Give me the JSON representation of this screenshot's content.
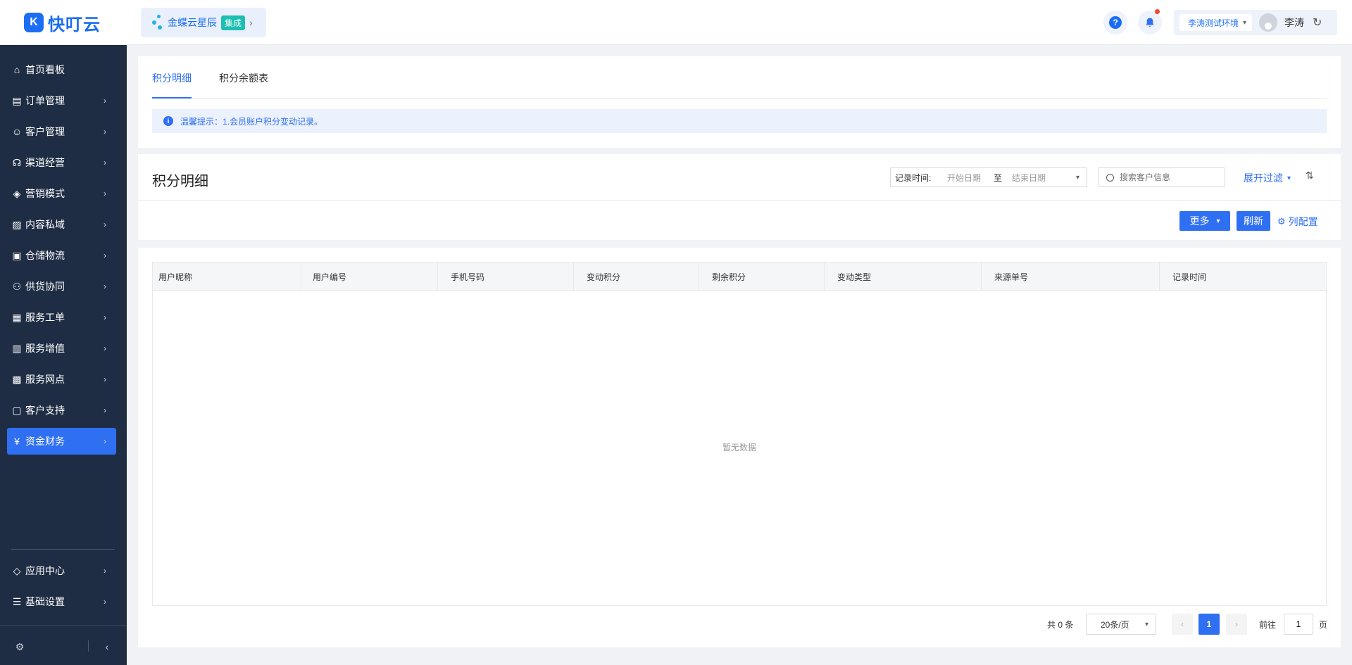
{
  "header": {
    "logo_text": "快叮云",
    "integration": {
      "name": "金蝶云星辰",
      "badge": "集成"
    },
    "environment": "李涛测试环境",
    "user_name": "李涛"
  },
  "sidebar": {
    "items": [
      {
        "label": "首页看板",
        "icon": "home-icon",
        "has_arrow": false
      },
      {
        "label": "订单管理",
        "icon": "clipboard-icon",
        "has_arrow": true
      },
      {
        "label": "客户管理",
        "icon": "user-icon",
        "has_arrow": true
      },
      {
        "label": "渠道经营",
        "icon": "channel-icon",
        "has_arrow": true
      },
      {
        "label": "营销模式",
        "icon": "tag-icon",
        "has_arrow": true
      },
      {
        "label": "内容私域",
        "icon": "image-icon",
        "has_arrow": true
      },
      {
        "label": "仓储物流",
        "icon": "warehouse-icon",
        "has_arrow": true
      },
      {
        "label": "供货协同",
        "icon": "supply-icon",
        "has_arrow": true
      },
      {
        "label": "服务工单",
        "icon": "ticket-icon",
        "has_arrow": true
      },
      {
        "label": "服务增值",
        "icon": "bag-icon",
        "has_arrow": true
      },
      {
        "label": "服务网点",
        "icon": "store-icon",
        "has_arrow": true
      },
      {
        "label": "客户支持",
        "icon": "support-icon",
        "has_arrow": true
      },
      {
        "label": "资金财务",
        "icon": "yen-icon",
        "has_arrow": true,
        "active": true
      }
    ],
    "bottom_items": [
      {
        "label": "应用中心",
        "icon": "cube-icon"
      },
      {
        "label": "基础设置",
        "icon": "settings-list-icon"
      }
    ]
  },
  "tabs": [
    {
      "label": "积分明细",
      "active": true
    },
    {
      "label": "积分余额表",
      "active": false
    }
  ],
  "notice": {
    "label": "温馨提示：",
    "text": "1.会员账户积分变动记录。"
  },
  "filter": {
    "page_title": "积分明细",
    "date_label": "记录时间:",
    "start_placeholder": "开始日期",
    "to_label": "至",
    "end_placeholder": "结束日期",
    "search_placeholder": "搜索客户信息",
    "expand_label": "展开过滤",
    "more_label": "更多",
    "refresh_label": "刷新",
    "column_config_label": "列配置"
  },
  "table": {
    "columns": [
      "用户昵称",
      "用户编号",
      "手机号码",
      "变动积分",
      "剩余积分",
      "变动类型",
      "来源单号",
      "记录时间"
    ],
    "empty_text": "暂无数据"
  },
  "pagination": {
    "total_label": "共 0 条",
    "page_size": "20条/页",
    "current_page": "1",
    "goto_label": "前往",
    "goto_value": "1",
    "goto_suffix": "页"
  },
  "colors": {
    "primary": "#2f6ff2",
    "sidebar_bg": "#1f2d44",
    "badge": "#1cbfb1",
    "notice_bg": "#ebf1fd"
  }
}
